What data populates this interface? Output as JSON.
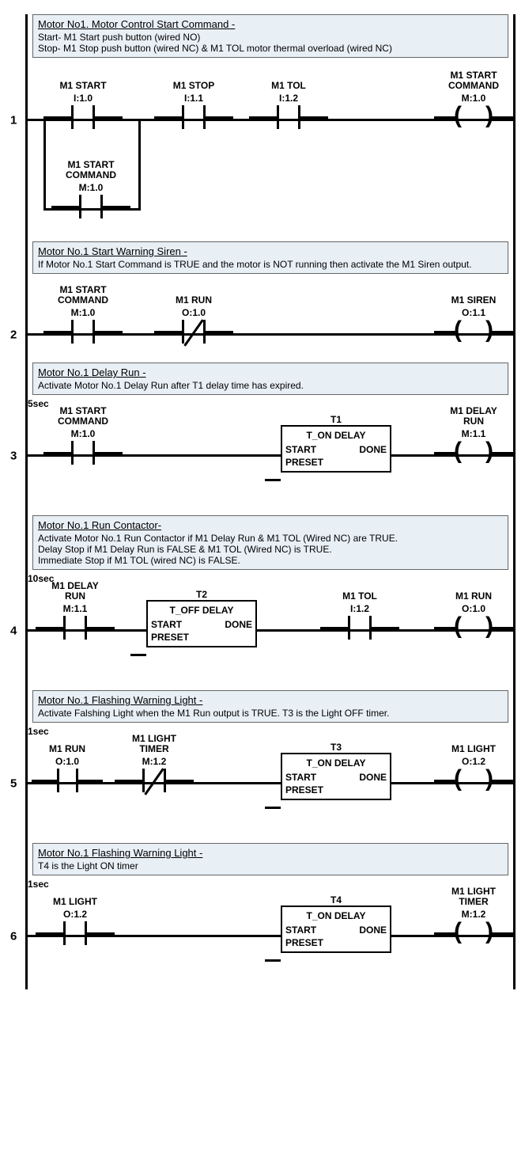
{
  "rungs": [
    {
      "num": "1",
      "comment_title": "Motor No1. Motor Control Start Command -",
      "comment_body": "Start- M1 Start push button (wired NO)\nStop- M1 Stop push button (wired NC) & M1 TOL motor thermal overload (wired NC)",
      "elems": {
        "m1start": {
          "name": "M1 START",
          "addr": "I:1.0"
        },
        "m1stop": {
          "name": "M1 STOP",
          "addr": "I:1.1"
        },
        "m1tol": {
          "name": "M1 TOL",
          "addr": "I:1.2"
        },
        "m1startcmd": {
          "name": "M1 START\nCOMMAND",
          "addr": "M:1.0"
        },
        "branch": {
          "name": "M1 START\nCOMMAND",
          "addr": "M:1.0"
        }
      }
    },
    {
      "num": "2",
      "comment_title": "Motor No.1 Start Warning Siren -",
      "comment_body": "If Motor No.1 Start Command is TRUE and the motor is NOT running then activate the M1 Siren output.",
      "elems": {
        "m1startcmd": {
          "name": "M1 START\nCOMMAND",
          "addr": "M:1.0"
        },
        "m1run": {
          "name": "M1 RUN",
          "addr": "O:1.0"
        },
        "m1siren": {
          "name": "M1 SIREN",
          "addr": "O:1.1"
        }
      }
    },
    {
      "num": "3",
      "comment_title": "Motor No.1 Delay Run -",
      "comment_body": "Activate Motor No.1 Delay Run after T1 delay time has expired.",
      "elems": {
        "m1startcmd": {
          "name": "M1 START\nCOMMAND",
          "addr": "M:1.0"
        },
        "t1": {
          "name": "T1",
          "type": "T_ON DELAY",
          "start": "START",
          "done": "DONE",
          "preset": "PRESET",
          "preset_val": "5sec"
        },
        "m1delayrun": {
          "name": "M1 DELAY\nRUN",
          "addr": "M:1.1"
        }
      }
    },
    {
      "num": "4",
      "comment_title": "Motor No.1 Run Contactor-",
      "comment_body": "Activate Motor No.1 Run Contactor if M1 Delay Run & M1 TOL (Wired NC) are TRUE.\nDelay Stop if M1 Delay Run is FALSE & M1 TOL (Wired NC) is TRUE.\nImmediate Stop if M1 TOL (wired NC) is FALSE.",
      "elems": {
        "m1delayrun": {
          "name": "M1 DELAY\nRUN",
          "addr": "M:1.1"
        },
        "t2": {
          "name": "T2",
          "type": "T_OFF DELAY",
          "start": "START",
          "done": "DONE",
          "preset": "PRESET",
          "preset_val": "10sec"
        },
        "m1tol": {
          "name": "M1 TOL",
          "addr": "I:1.2"
        },
        "m1run": {
          "name": "M1 RUN",
          "addr": "O:1.0"
        }
      }
    },
    {
      "num": "5",
      "comment_title": "Motor No.1  Flashing Warning Light -",
      "comment_body": "Activate Falshing Light when the M1 Run output is TRUE. T3 is the Light OFF timer.",
      "elems": {
        "m1run": {
          "name": "M1 RUN",
          "addr": "O:1.0"
        },
        "m1lighttimer": {
          "name": "M1 LIGHT\nTIMER",
          "addr": "M:1.2"
        },
        "t3": {
          "name": "T3",
          "type": "T_ON DELAY",
          "start": "START",
          "done": "DONE",
          "preset": "PRESET",
          "preset_val": "1sec"
        },
        "m1light": {
          "name": "M1 LIGHT",
          "addr": "O:1.2"
        }
      }
    },
    {
      "num": "6",
      "comment_title": "Motor No.1 Flashing Warning Light -",
      "comment_body": "T4 is the Light ON timer",
      "elems": {
        "m1light": {
          "name": "M1 LIGHT",
          "addr": "O:1.2"
        },
        "t4": {
          "name": "T4",
          "type": "T_ON DELAY",
          "start": "START",
          "done": "DONE",
          "preset": "PRESET",
          "preset_val": "1sec"
        },
        "m1lighttimer": {
          "name": "M1 LIGHT\nTIMER",
          "addr": "M:1.2"
        }
      }
    }
  ],
  "chart_data": {
    "type": "ladder_logic",
    "rungs": [
      {
        "rung": 1,
        "description": "Motor No1. Motor Control Start Command",
        "logic": "(I:1.0 OR M:1.0) AND I:1.1 AND I:1.2 -> M:1.0",
        "inputs": [
          {
            "tag": "M1 START",
            "addr": "I:1.0",
            "type": "NO"
          },
          {
            "tag": "M1 START COMMAND",
            "addr": "M:1.0",
            "type": "NO",
            "branch": true
          },
          {
            "tag": "M1 STOP",
            "addr": "I:1.1",
            "type": "NO"
          },
          {
            "tag": "M1 TOL",
            "addr": "I:1.2",
            "type": "NO"
          }
        ],
        "output": {
          "tag": "M1 START COMMAND",
          "addr": "M:1.0",
          "type": "coil"
        }
      },
      {
        "rung": 2,
        "description": "Motor No.1 Start Warning Siren",
        "logic": "M:1.0 AND NOT O:1.0 -> O:1.1",
        "inputs": [
          {
            "tag": "M1 START COMMAND",
            "addr": "M:1.0",
            "type": "NO"
          },
          {
            "tag": "M1 RUN",
            "addr": "O:1.0",
            "type": "NC"
          }
        ],
        "output": {
          "tag": "M1 SIREN",
          "addr": "O:1.1",
          "type": "coil"
        }
      },
      {
        "rung": 3,
        "description": "Motor No.1 Delay Run",
        "logic": "M:1.0 -> T1(TON,5s).DONE -> M:1.1",
        "inputs": [
          {
            "tag": "M1 START COMMAND",
            "addr": "M:1.0",
            "type": "NO"
          }
        ],
        "function_block": {
          "name": "T1",
          "type": "T_ON DELAY",
          "preset": "5sec"
        },
        "output": {
          "tag": "M1 DELAY RUN",
          "addr": "M:1.1",
          "type": "coil"
        }
      },
      {
        "rung": 4,
        "description": "Motor No.1 Run Contactor",
        "logic": "M:1.1 -> T2(TOF,10s).DONE AND I:1.2 -> O:1.0",
        "inputs": [
          {
            "tag": "M1 DELAY RUN",
            "addr": "M:1.1",
            "type": "NO"
          }
        ],
        "function_block": {
          "name": "T2",
          "type": "T_OFF DELAY",
          "preset": "10sec"
        },
        "inputs_after": [
          {
            "tag": "M1 TOL",
            "addr": "I:1.2",
            "type": "NO"
          }
        ],
        "output": {
          "tag": "M1 RUN",
          "addr": "O:1.0",
          "type": "coil"
        }
      },
      {
        "rung": 5,
        "description": "Motor No.1 Flashing Warning Light (OFF timer)",
        "logic": "O:1.0 AND NOT M:1.2 -> T3(TON,1s).DONE -> O:1.2",
        "inputs": [
          {
            "tag": "M1 RUN",
            "addr": "O:1.0",
            "type": "NO"
          },
          {
            "tag": "M1 LIGHT TIMER",
            "addr": "M:1.2",
            "type": "NC"
          }
        ],
        "function_block": {
          "name": "T3",
          "type": "T_ON DELAY",
          "preset": "1sec"
        },
        "output": {
          "tag": "M1 LIGHT",
          "addr": "O:1.2",
          "type": "coil"
        }
      },
      {
        "rung": 6,
        "description": "Motor No.1 Flashing Warning Light (ON timer)",
        "logic": "O:1.2 -> T4(TON,1s).DONE -> M:1.2",
        "inputs": [
          {
            "tag": "M1 LIGHT",
            "addr": "O:1.2",
            "type": "NO"
          }
        ],
        "function_block": {
          "name": "T4",
          "type": "T_ON DELAY",
          "preset": "1sec"
        },
        "output": {
          "tag": "M1 LIGHT TIMER",
          "addr": "M:1.2",
          "type": "coil"
        }
      }
    ]
  }
}
